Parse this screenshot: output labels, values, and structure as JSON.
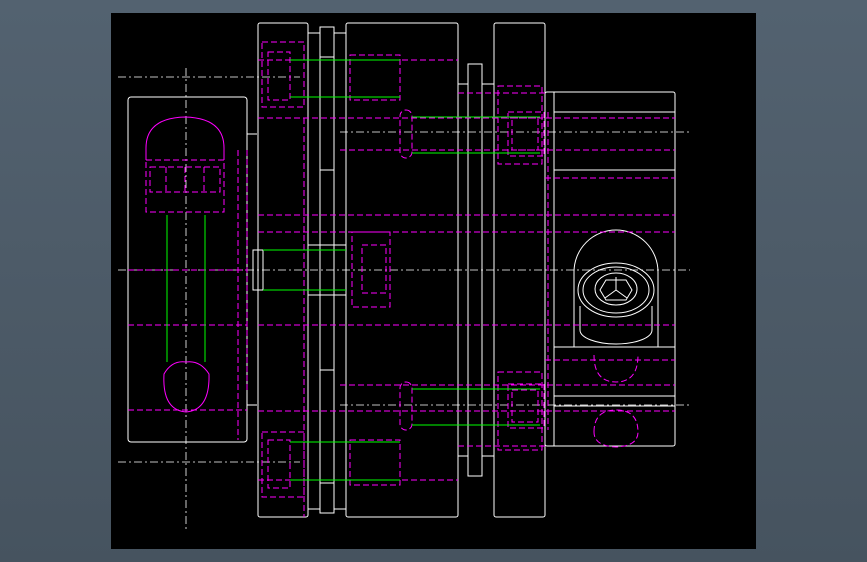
{
  "viewer": {
    "background": "#4f5d6a",
    "canvas_background": "#000000"
  },
  "colors": {
    "outline": "#ffffff",
    "hidden": "#ff00ff",
    "screw": "#00ff00",
    "centerline": "#ffffff"
  },
  "drawing": {
    "subject": "coupling-assembly",
    "views": [
      "side-view",
      "end-view",
      "section"
    ]
  }
}
